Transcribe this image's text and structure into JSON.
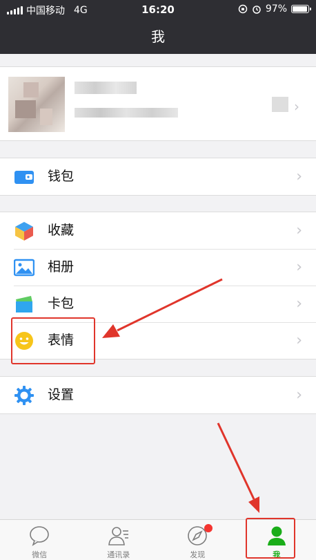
{
  "status": {
    "carrier": "中国移动",
    "network": "4G",
    "time": "16:20",
    "battery": "97%"
  },
  "nav": {
    "title": "我"
  },
  "menu": {
    "wallet": "钱包",
    "favorites": "收藏",
    "album": "相册",
    "cards": "卡包",
    "stickers": "表情",
    "settings": "设置"
  },
  "tabs": [
    {
      "label": "微信",
      "icon": "chat-bubble-icon"
    },
    {
      "label": "通讯录",
      "icon": "contacts-icon"
    },
    {
      "label": "发现",
      "icon": "compass-icon"
    },
    {
      "label": "我",
      "icon": "person-icon",
      "active": true
    }
  ],
  "colors": {
    "nav_bg": "#2e2e33",
    "accent_green": "#1aad19",
    "annotation_red": "#e0352b"
  }
}
